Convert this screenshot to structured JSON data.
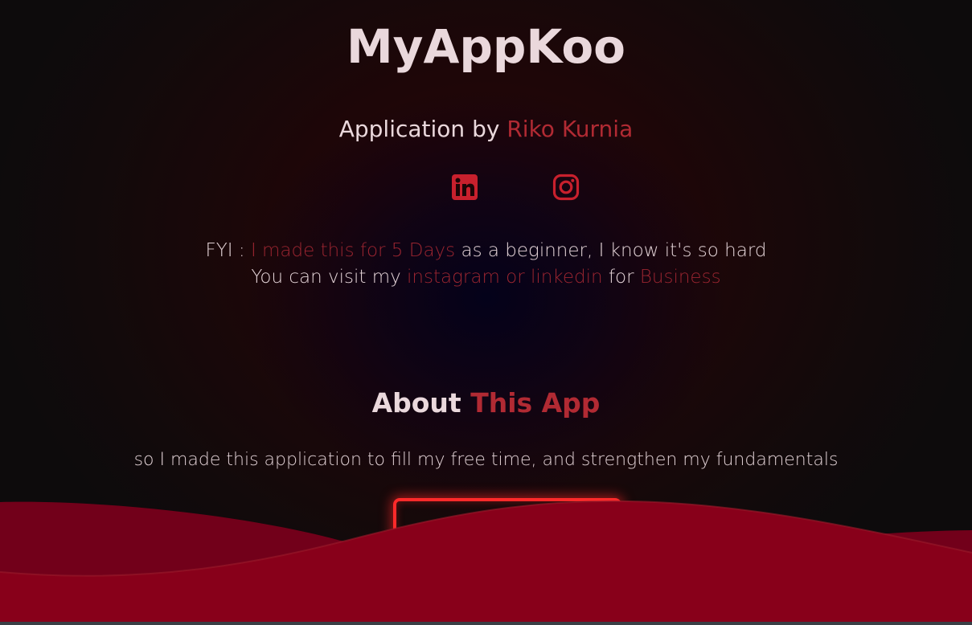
{
  "header": {
    "title": "MyAppKoo",
    "byline_prefix": "Application by",
    "author": "Riko Kurnia"
  },
  "socials": [
    {
      "name": "LinkedIn",
      "icon": "linkedin-icon"
    },
    {
      "name": "Instagram",
      "icon": "instagram-icon"
    }
  ],
  "fyi": {
    "line1_prefix": "FYI :",
    "line1_highlight": "I made this for 5 Days",
    "line1_suffix": "as a beginner, I know it's so hard",
    "line2_prefix": "You can visit my",
    "line2_link": "instagram or linkedin",
    "line2_middle": "for",
    "line2_highlight": "Business"
  },
  "about": {
    "heading_plain": "About",
    "heading_accent": "This App",
    "text": "so I made this application to fill my free time, and strengthen my fundamentals"
  },
  "colors": {
    "accent": "#b12a33",
    "wave": "#8a0018",
    "wave_back": "#75001a",
    "button_glow": "#ff2a2a",
    "background": "#0f0b0c"
  }
}
